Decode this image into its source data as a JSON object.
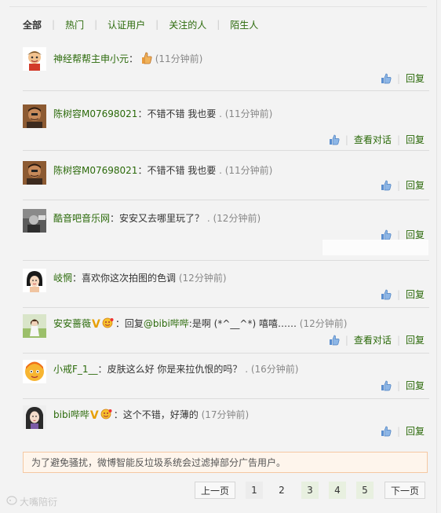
{
  "tabs": [
    "全部",
    "热门",
    "认证用户",
    "关注的人",
    "陌生人"
  ],
  "actions": {
    "reply": "回复",
    "view_conversation": "查看对话"
  },
  "comments": [
    {
      "user": "神经帮帮主申小元",
      "text": "",
      "has_thumb_emoji": true,
      "time": "(11分钟前)",
      "show_conversation": false
    },
    {
      "user": "陈树容M07698021",
      "text": "不错不错 我也要",
      "time": " . (11分钟前)",
      "show_conversation": true
    },
    {
      "user": "陈树容M07698021",
      "text": "不错不错 我也要",
      "time": " . (11分钟前)",
      "show_conversation": false
    },
    {
      "user": "酷音吧音乐网",
      "text": "安安又去哪里玩了？",
      "time": " . (12分钟前)",
      "show_conversation": false
    },
    {
      "user": "岐惘",
      "text": "喜欢你这次拍图的色调",
      "time": " (12分钟前)",
      "show_conversation": false
    },
    {
      "user": "安安蔷薇",
      "verified": "V",
      "reply_prefix": "回复",
      "mention": "@bibi哔哔",
      "text": ":是啊 (*^__^*) 嘻嘻……",
      "time": " (12分钟前)",
      "show_conversation": true
    },
    {
      "user": "小戒F_1__",
      "text": "皮肤这么好 你是来拉仇恨的吗？",
      "time": " . (16分钟前)",
      "show_conversation": false
    },
    {
      "user": "bibi哔哔",
      "verified": "V",
      "text": "这个不错，好薄的",
      "time": " (17分钟前)",
      "show_conversation": false
    }
  ],
  "notice": "为了避免骚扰，微博智能反垃圾系统会过滤掉部分广告用户。",
  "pager": {
    "prev": "上一页",
    "next": "下一页",
    "pages": [
      "1",
      "2",
      "3",
      "4",
      "5"
    ]
  },
  "watermark": "大嘴陪衍",
  "colors": {
    "link_green": "#2b6a0a",
    "notice_border": "#f5c8a2",
    "notice_bg": "#fef5ec"
  }
}
